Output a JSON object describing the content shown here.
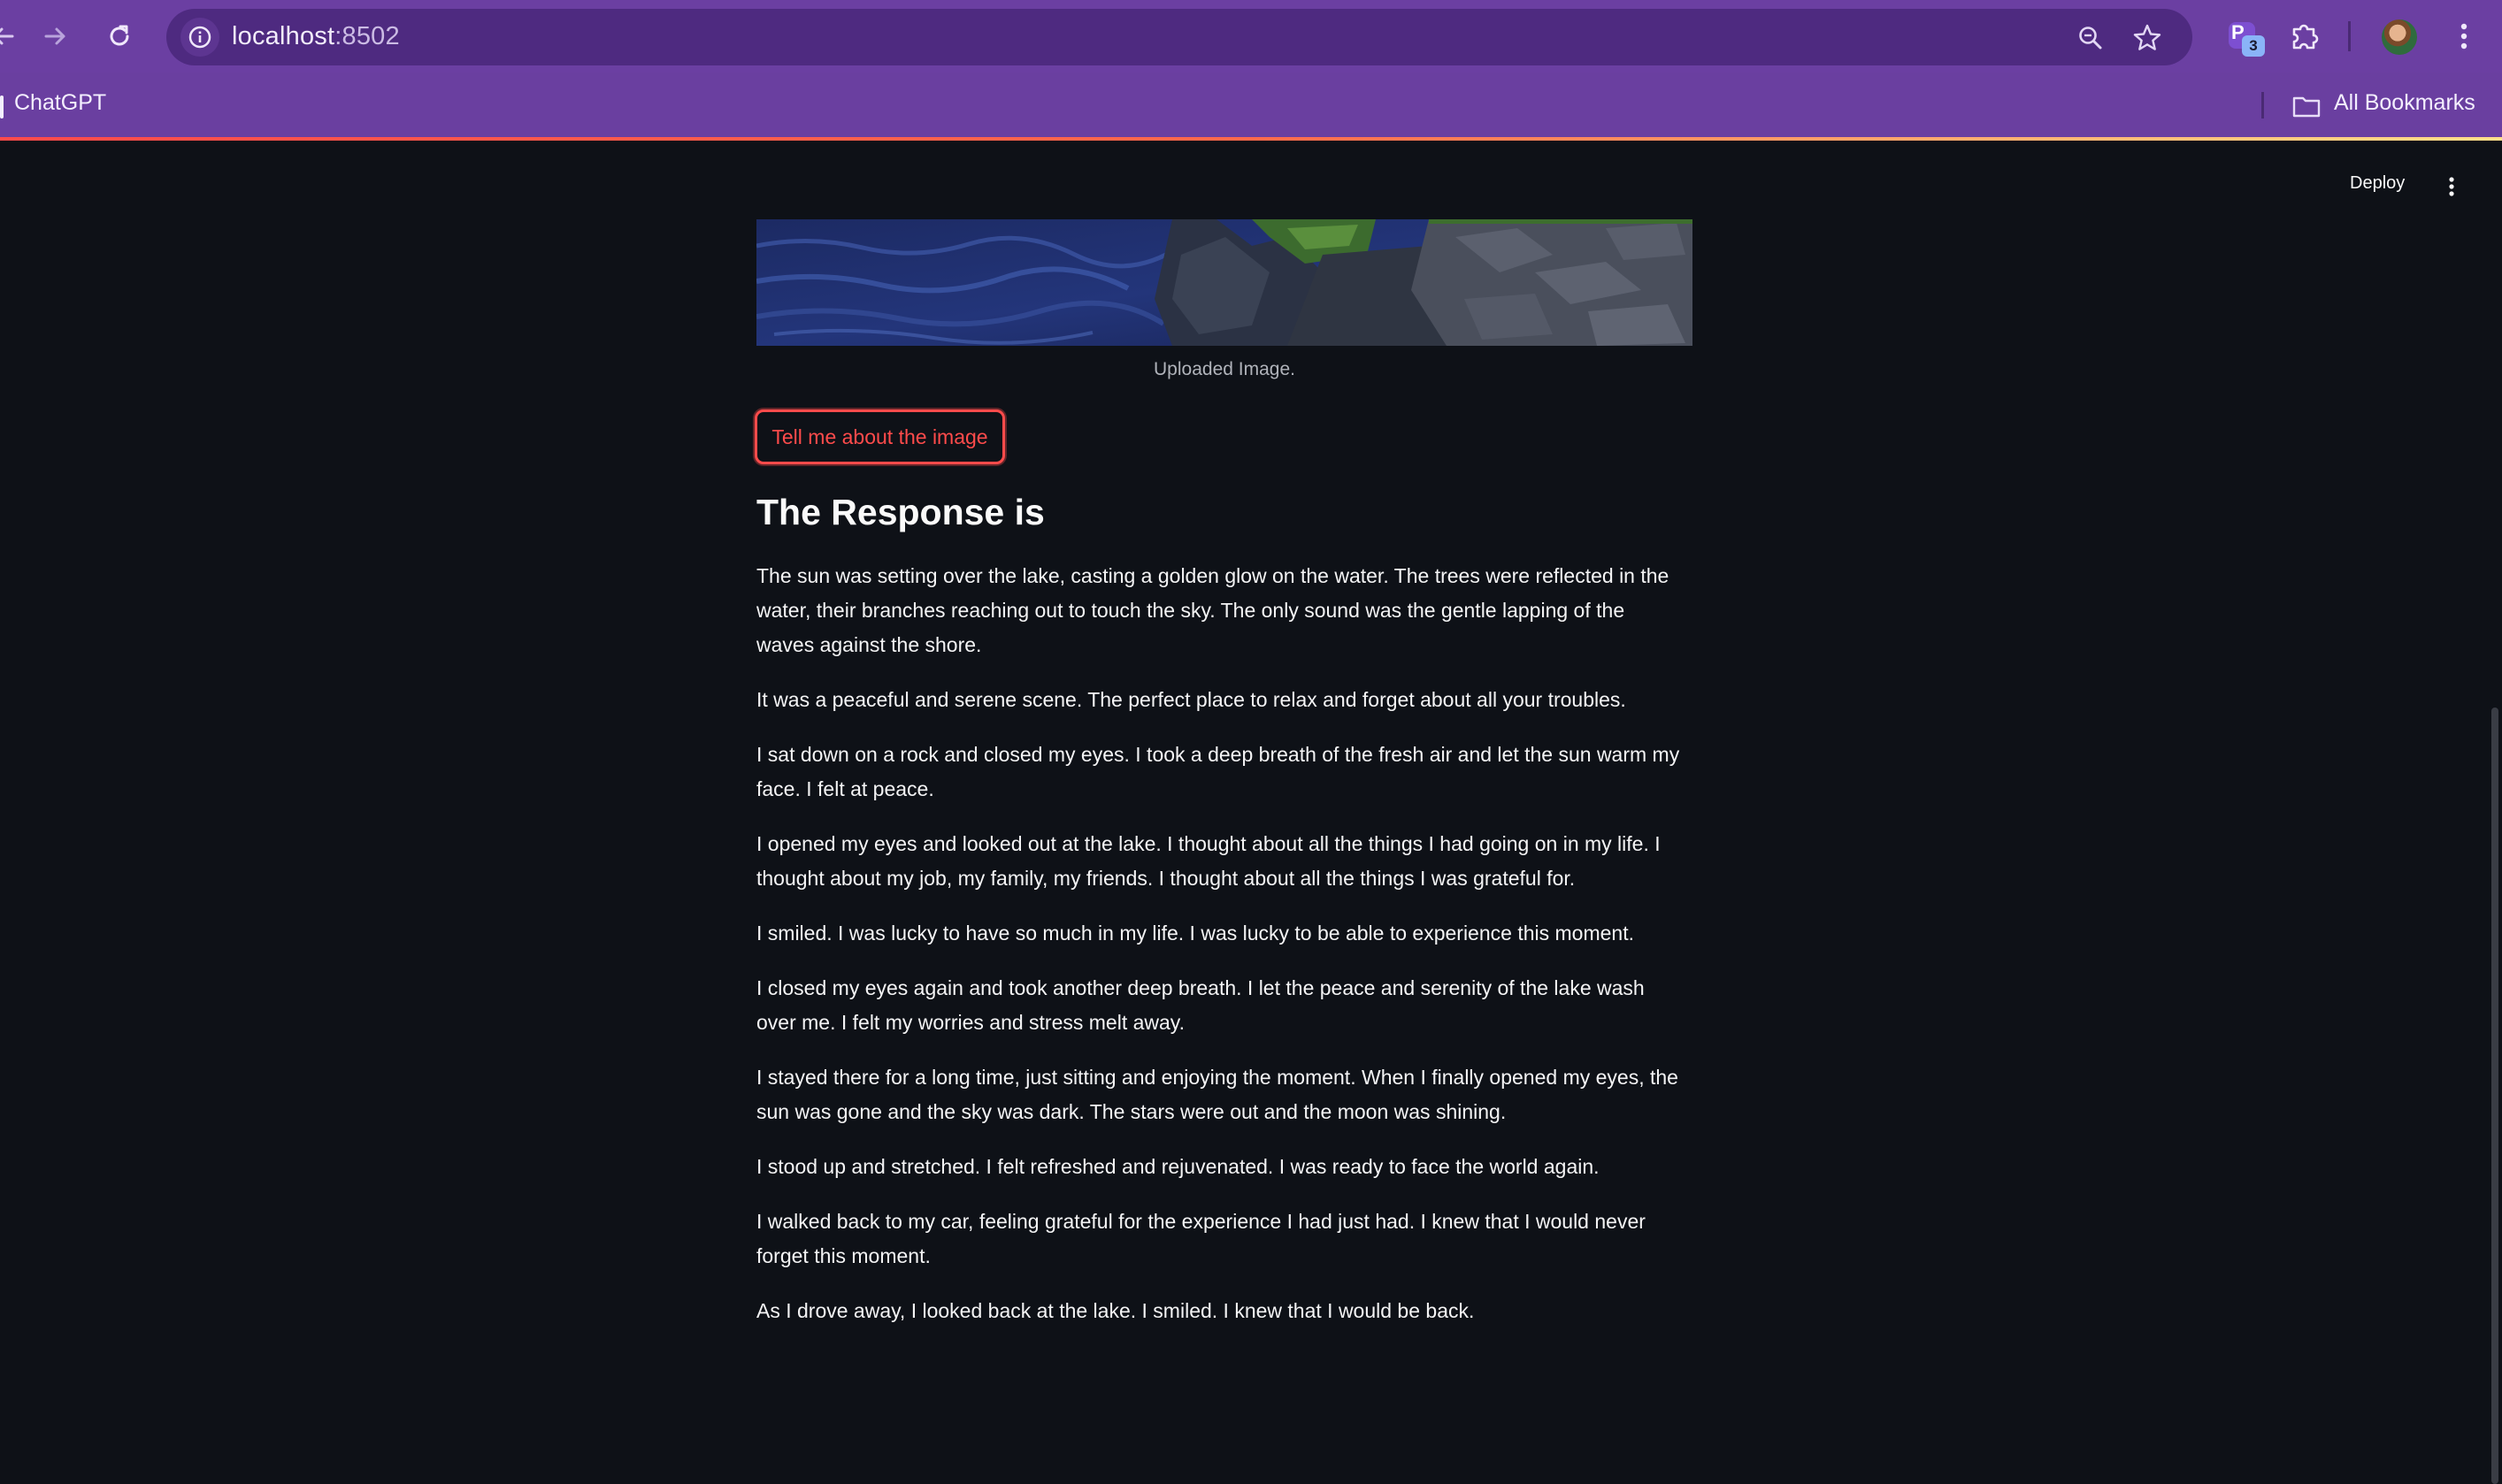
{
  "browser": {
    "url_host": "localhost",
    "url_port": ":8502",
    "extension_badge": "3",
    "extension_letter": "P",
    "bookmarks": {
      "first_item": "ChatGPT",
      "all_bookmarks": "All Bookmarks"
    },
    "icons": [
      "back-icon",
      "forward-icon",
      "reload-icon",
      "site-info-icon",
      "zoom-icon",
      "star-icon",
      "extension-icon",
      "puzzle-icon",
      "avatar",
      "menu-icon",
      "folder-icon"
    ]
  },
  "app": {
    "deploy_label": "Deploy",
    "image_caption": "Uploaded Image.",
    "button_label": "Tell me about the image",
    "response_title": "The Response is",
    "paragraphs": [
      "The sun was setting over the lake, casting a golden glow on the water. The trees were reflected in the water, their branches reaching out to touch the sky. The only sound was the gentle lapping of the waves against the shore.",
      "It was a peaceful and serene scene. The perfect place to relax and forget about all your troubles.",
      "I sat down on a rock and closed my eyes. I took a deep breath of the fresh air and let the sun warm my face. I felt at peace.",
      "I opened my eyes and looked out at the lake. I thought about all the things I had going on in my life. I thought about my job, my family, my friends. I thought about all the things I was grateful for.",
      "I smiled. I was lucky to have so much in my life. I was lucky to be able to experience this moment.",
      "I closed my eyes again and took another deep breath. I let the peace and serenity of the lake wash over me. I felt my worries and stress melt away.",
      "I stayed there for a long time, just sitting and enjoying the moment. When I finally opened my eyes, the sun was gone and the sky was dark. The stars were out and the moon was shining.",
      "I stood up and stretched. I felt refreshed and rejuvenated. I was ready to face the world again.",
      "I walked back to my car, feeling grateful for the experience I had just had. I knew that I would never forget this moment.",
      "As I drove away, I looked back at the lake. I smiled. I knew that I would be back."
    ]
  },
  "colors": {
    "chrome": "#6b3fa2",
    "background": "#0e1117",
    "accent": "#ff4b4b"
  }
}
